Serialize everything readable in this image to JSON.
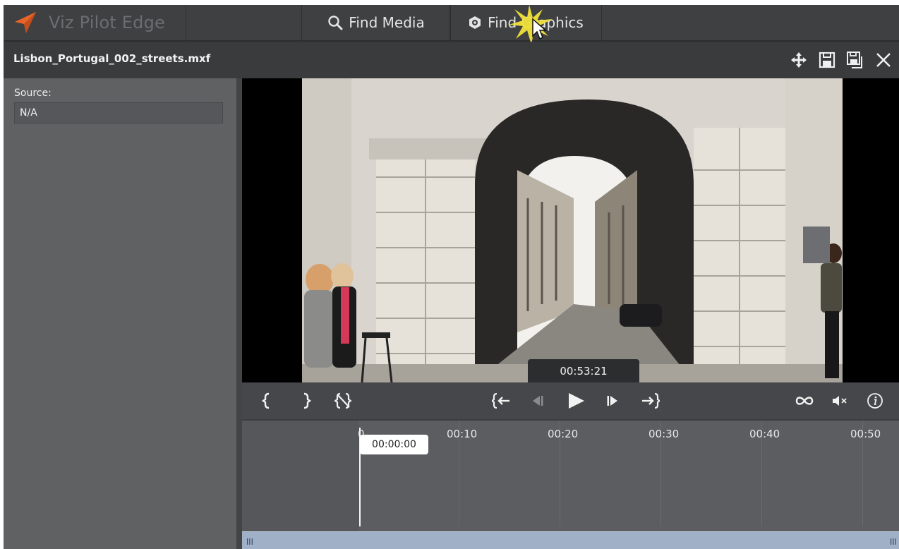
{
  "brand": {
    "name": "Viz Pilot Edge",
    "accent": "#e9642a"
  },
  "nav": {
    "find_media": {
      "label": "Find Media",
      "icon": "search-icon"
    },
    "find_graphics": {
      "label": "Find Graphics",
      "icon": "graphics-icon"
    }
  },
  "clip": {
    "title": "Lisbon_Portugal_002_streets.mxf",
    "actions": [
      "move-icon",
      "save-icon",
      "save-as-icon",
      "close-icon"
    ]
  },
  "metadata": {
    "source_label": "Source:",
    "source_value": "N/A"
  },
  "player": {
    "timecode": "00:53:21",
    "controls": [
      "mark-in",
      "mark-out",
      "clear-marks",
      "go-to-in",
      "step-back",
      "play",
      "step-forward",
      "go-to-out",
      "loop",
      "mute",
      "info"
    ]
  },
  "timeline": {
    "ticks": [
      "0",
      "00:10",
      "00:20",
      "00:30",
      "00:40",
      "00:50"
    ],
    "playhead": "00:00:00"
  }
}
